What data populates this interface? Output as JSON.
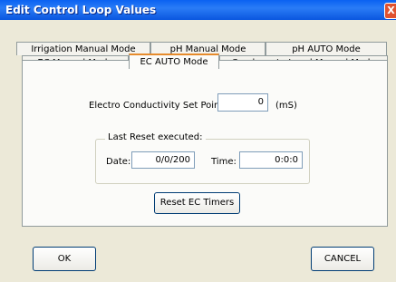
{
  "window": {
    "title": "Edit Control Loop Values",
    "close_glyph": "X"
  },
  "tabs": {
    "row1": [
      "Irrigation Manual Mode",
      "pH Manual Mode",
      "pH AUTO Mode"
    ],
    "row2": [
      "EC Manual Mode",
      "EC AUTO Mode",
      "Condensate Level Manual Mode"
    ],
    "active": "EC AUTO Mode"
  },
  "ec_setpoint": {
    "label": "Electro Conductivity Set Point:",
    "value": "0",
    "unit": "(mS)"
  },
  "last_reset": {
    "legend": "Last Reset executed:",
    "date_label": "Date:",
    "date_value": "0/0/200",
    "time_label": "Time:",
    "time_value": "0:0:0"
  },
  "buttons": {
    "reset": "Reset EC Timers",
    "ok": "OK",
    "cancel": "CANCEL"
  }
}
